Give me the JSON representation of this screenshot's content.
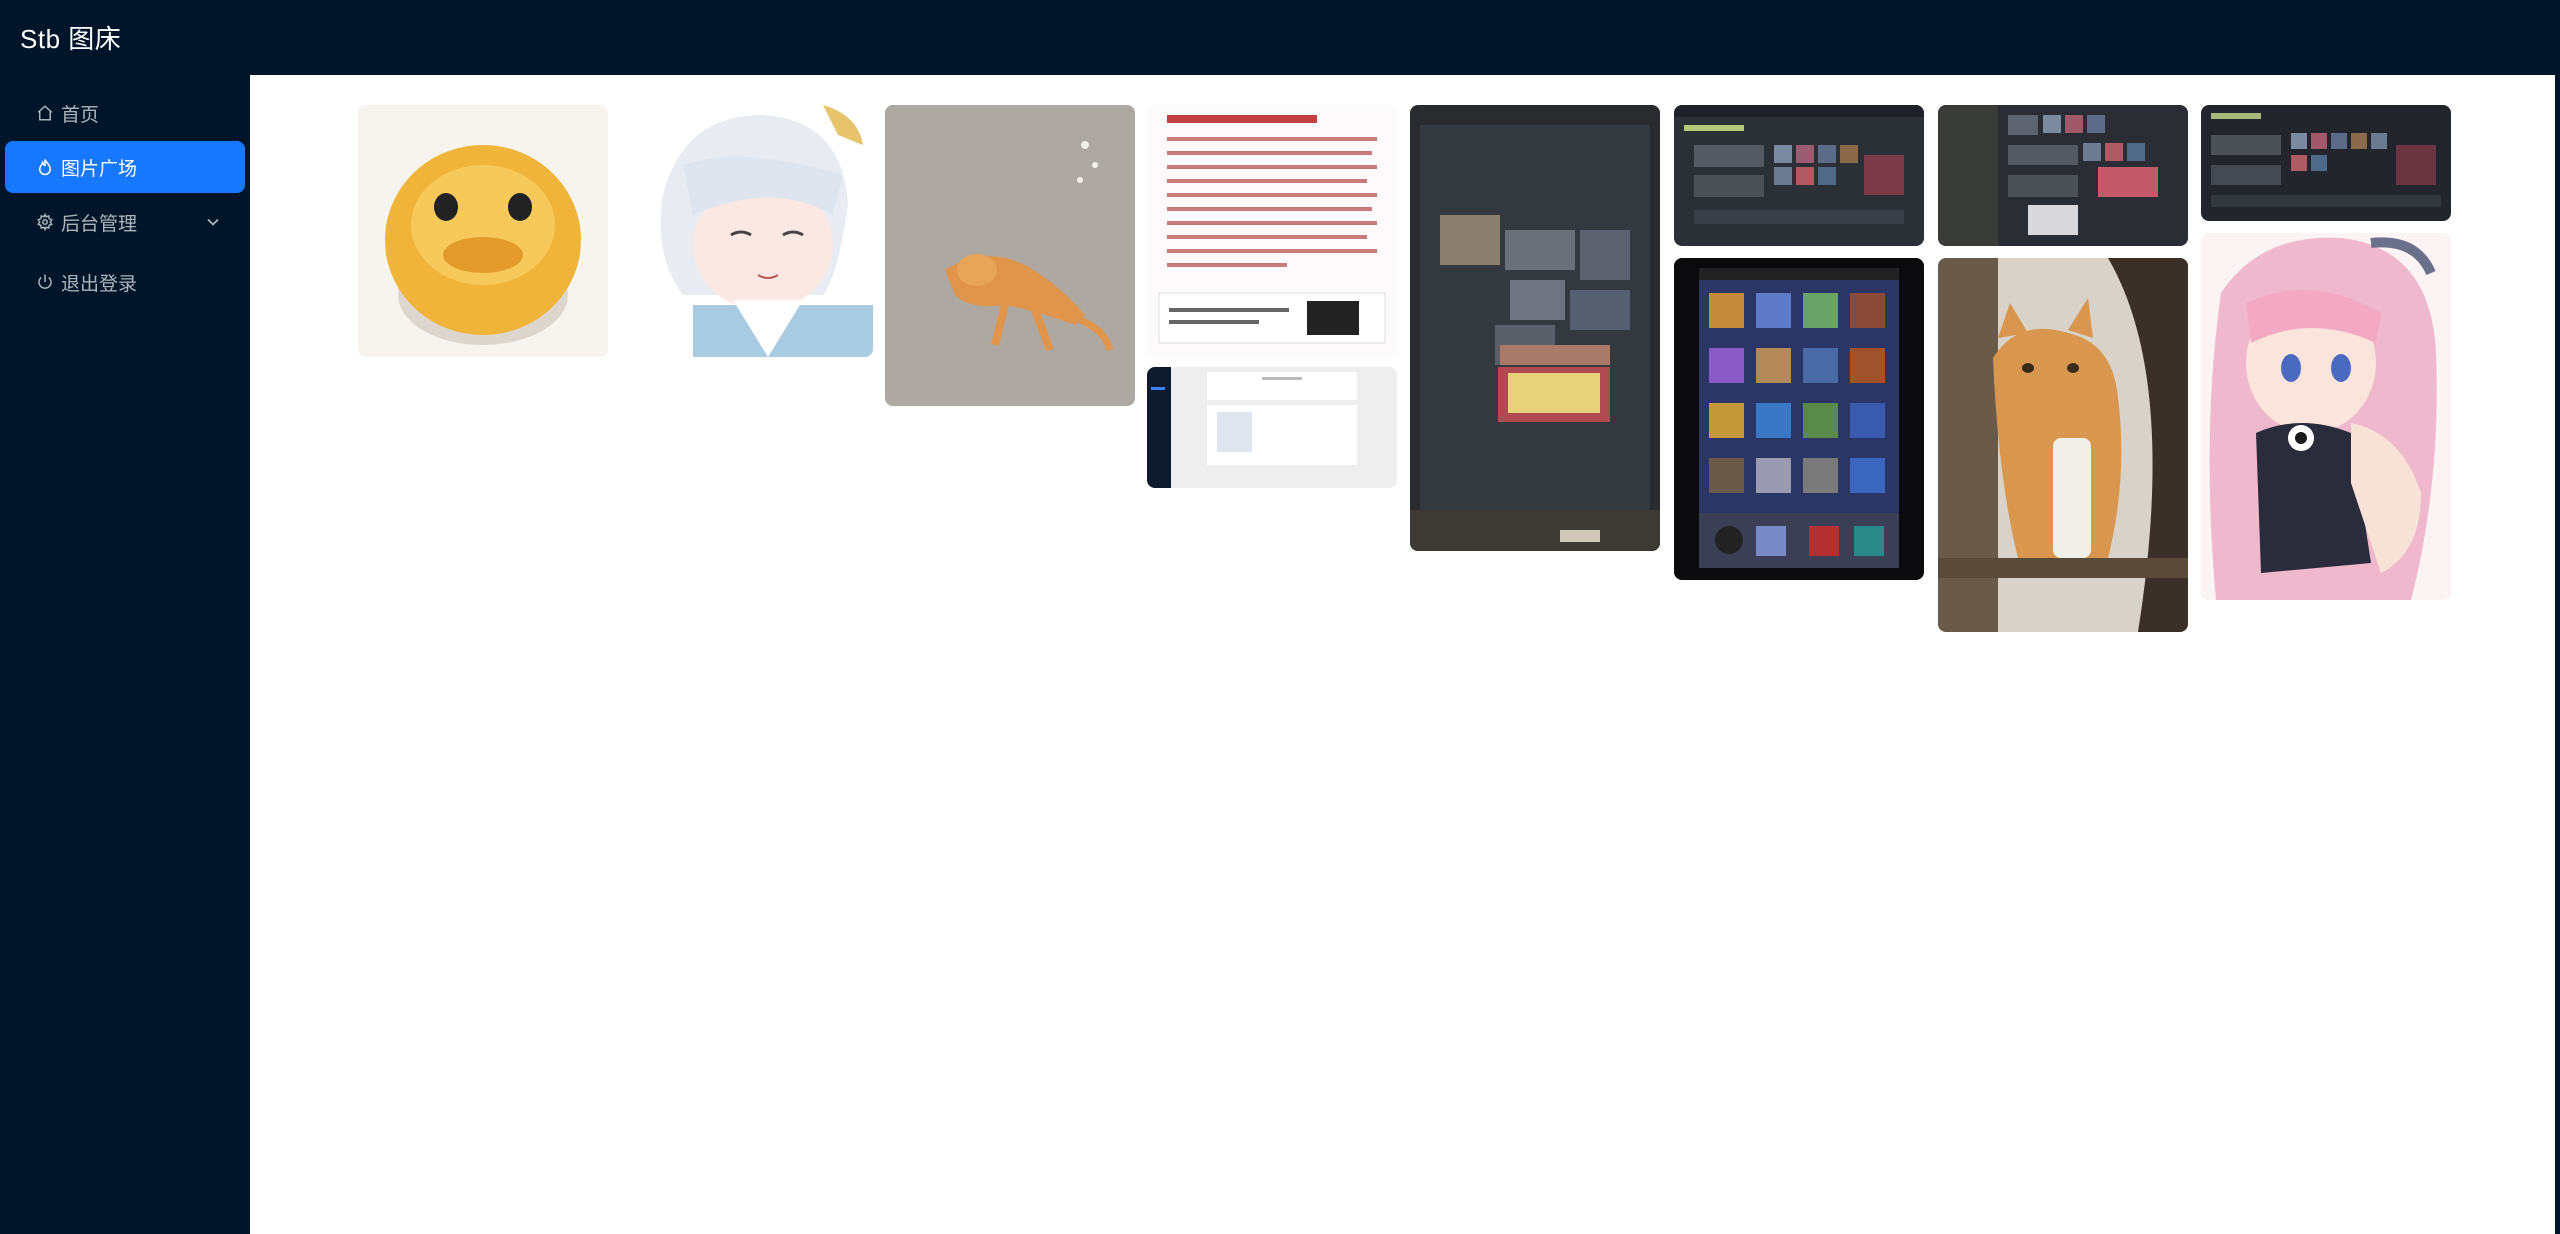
{
  "app": {
    "title": "Stb 图床"
  },
  "sidebar": {
    "items": [
      {
        "label": "首页",
        "icon": "home-icon",
        "active": false
      },
      {
        "label": "图片广场",
        "icon": "fire-icon",
        "active": true
      },
      {
        "label": "后台管理",
        "icon": "gear-icon",
        "active": false,
        "expandable": true
      },
      {
        "label": "退出登录",
        "icon": "power-icon",
        "active": false
      }
    ]
  },
  "colors": {
    "header_bg": "#001529",
    "sidebar_bg": "#001529",
    "accent": "#1677ff",
    "text_muted": "rgba(255,255,255,0.68)"
  },
  "gallery": {
    "images": [
      {
        "name": "yellow-blob-emoji"
      },
      {
        "name": "white-haired-anime-character"
      },
      {
        "name": "orange-cat-lying-on-ground"
      },
      {
        "name": "chinese-news-article-screenshot"
      },
      {
        "name": "web-page-screenshot"
      },
      {
        "name": "photo-of-monitor-game-inventory"
      },
      {
        "name": "game-inventory-screenshot-1"
      },
      {
        "name": "phone-home-screen-photo"
      },
      {
        "name": "game-inventory-screenshot-2"
      },
      {
        "name": "orange-cat-sitting-on-shelf"
      },
      {
        "name": "game-inventory-screenshot-3"
      },
      {
        "name": "pink-haired-anime-girl"
      }
    ]
  }
}
